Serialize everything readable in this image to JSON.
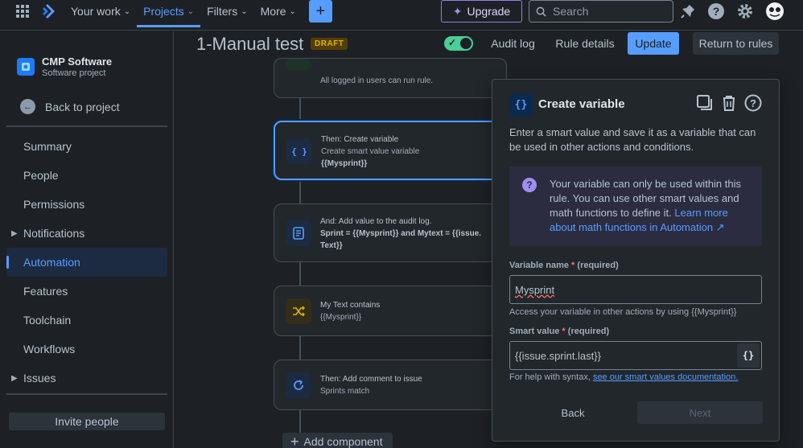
{
  "topbar": {
    "nav": [
      {
        "label": "Your work",
        "active": false
      },
      {
        "label": "Projects",
        "active": true
      },
      {
        "label": "Filters",
        "active": false
      },
      {
        "label": "More",
        "active": false
      }
    ],
    "upgrade_label": "Upgrade",
    "search_placeholder": "Search"
  },
  "sidebar": {
    "project_name": "CMP Software",
    "project_type": "Software project",
    "back_label": "Back to project",
    "items": [
      {
        "label": "Summary"
      },
      {
        "label": "People"
      },
      {
        "label": "Permissions"
      },
      {
        "label": "Notifications"
      },
      {
        "label": "Automation"
      },
      {
        "label": "Features"
      },
      {
        "label": "Toolchain"
      },
      {
        "label": "Workflows"
      },
      {
        "label": "Issues"
      }
    ],
    "invite_label": "Invite people"
  },
  "header": {
    "title": "1-Manual test",
    "badge": "DRAFT",
    "toggle_on": true,
    "audit_log": "Audit log",
    "rule_details": "Rule details",
    "update": "Update",
    "return": "Return to rules"
  },
  "rule": {
    "top_partial": "All logged in users can run rule.",
    "cards": [
      {
        "line1": "Then: Create variable",
        "line2": "Create smart value variable",
        "line3": "{{Mysprint}}"
      },
      {
        "line1": "And: Add value to the audit log.",
        "line2": "Sprint = {{Mysprint}} and Mytext = {{issue.",
        "line3": "Text}}"
      },
      {
        "line1": "My Text contains",
        "line2": "{{Mysprint}}",
        "line3": ""
      },
      {
        "line1": "Then: Add comment to issue",
        "line2": "Sprints match",
        "line3": ""
      }
    ],
    "add_component": "Add component"
  },
  "panel": {
    "title": "Create variable",
    "description": "Enter a smart value and save it as a variable that can be used in other actions and conditions.",
    "info_text": "Your variable can only be used within this rule. You can use other smart values and math functions to define it.",
    "info_link": "Learn more about math functions in Automation ↗",
    "var_label": "Variable name",
    "var_req": "(required)",
    "var_value": "Mysprint",
    "var_help": "Access your variable in other actions by using {{Mysprint}}",
    "smart_label": "Smart value",
    "smart_req": "(required)",
    "smart_value": "{{issue.sprint.last}}",
    "smart_help_prefix": "For help with syntax,",
    "smart_help_link": "see our smart values documentation.",
    "back": "Back",
    "next": "Next"
  },
  "colors": {
    "accent": "#579dff",
    "background": "#1d2125",
    "toggle_on": "#4bce97",
    "draft_badge": "#e2b203"
  }
}
